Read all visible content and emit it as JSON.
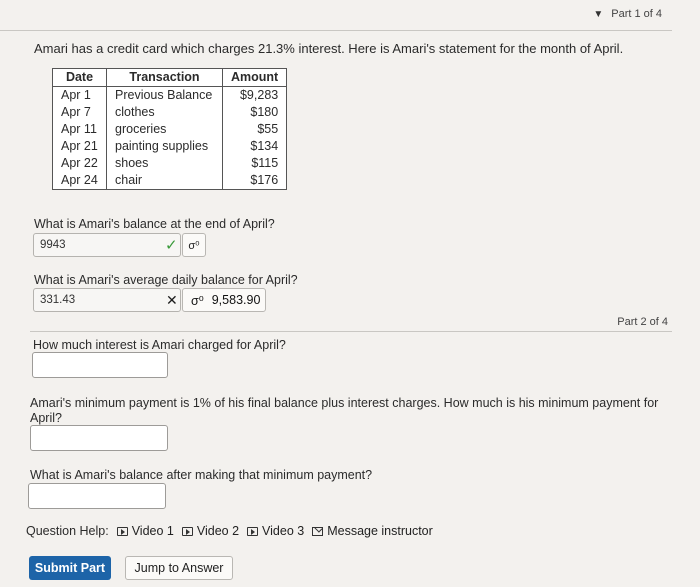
{
  "part1": {
    "label": "Part 1 of 4"
  },
  "intro": "Amari has a credit card which charges 21.3% interest. Here is Amari's statement for the month of April.",
  "statement": {
    "headers": [
      "Date",
      "Transaction",
      "Amount"
    ],
    "rows": [
      {
        "date": "Apr 1",
        "transaction": "Previous Balance",
        "amount": "$9,283"
      },
      {
        "date": "Apr 7",
        "transaction": "clothes",
        "amount": "$180"
      },
      {
        "date": "Apr 11",
        "transaction": "groceries",
        "amount": "$55"
      },
      {
        "date": "Apr 21",
        "transaction": "painting supplies",
        "amount": "$134"
      },
      {
        "date": "Apr 22",
        "transaction": "shoes",
        "amount": "$115"
      },
      {
        "date": "Apr 24",
        "transaction": "chair",
        "amount": "$176"
      }
    ]
  },
  "q1": {
    "text": "What is Amari's balance at the end of April?",
    "answer": "9943"
  },
  "q2": {
    "text": "What is Amari's average daily balance for April?",
    "answer": "331.43",
    "correct_answer": "9,583.90"
  },
  "part2": {
    "label": "Part 2 of 4"
  },
  "q3": {
    "text": "How much interest is Amari charged for April?",
    "answer": ""
  },
  "q4": {
    "text": "Amari's minimum payment is 1% of his final balance plus interest charges. How much is his minimum payment for April?",
    "answer": ""
  },
  "q5": {
    "text": "What is Amari's balance after making that minimum payment?",
    "answer": ""
  },
  "help": {
    "label": "Question Help:",
    "video1": "Video 1",
    "video2": "Video 2",
    "video3": "Video 3",
    "message": "Message instructor"
  },
  "buttons": {
    "submit": "Submit Part",
    "jump": "Jump to Answer"
  },
  "colors": {
    "primary": "#1d64a8",
    "correct": "#3a9a3a"
  }
}
